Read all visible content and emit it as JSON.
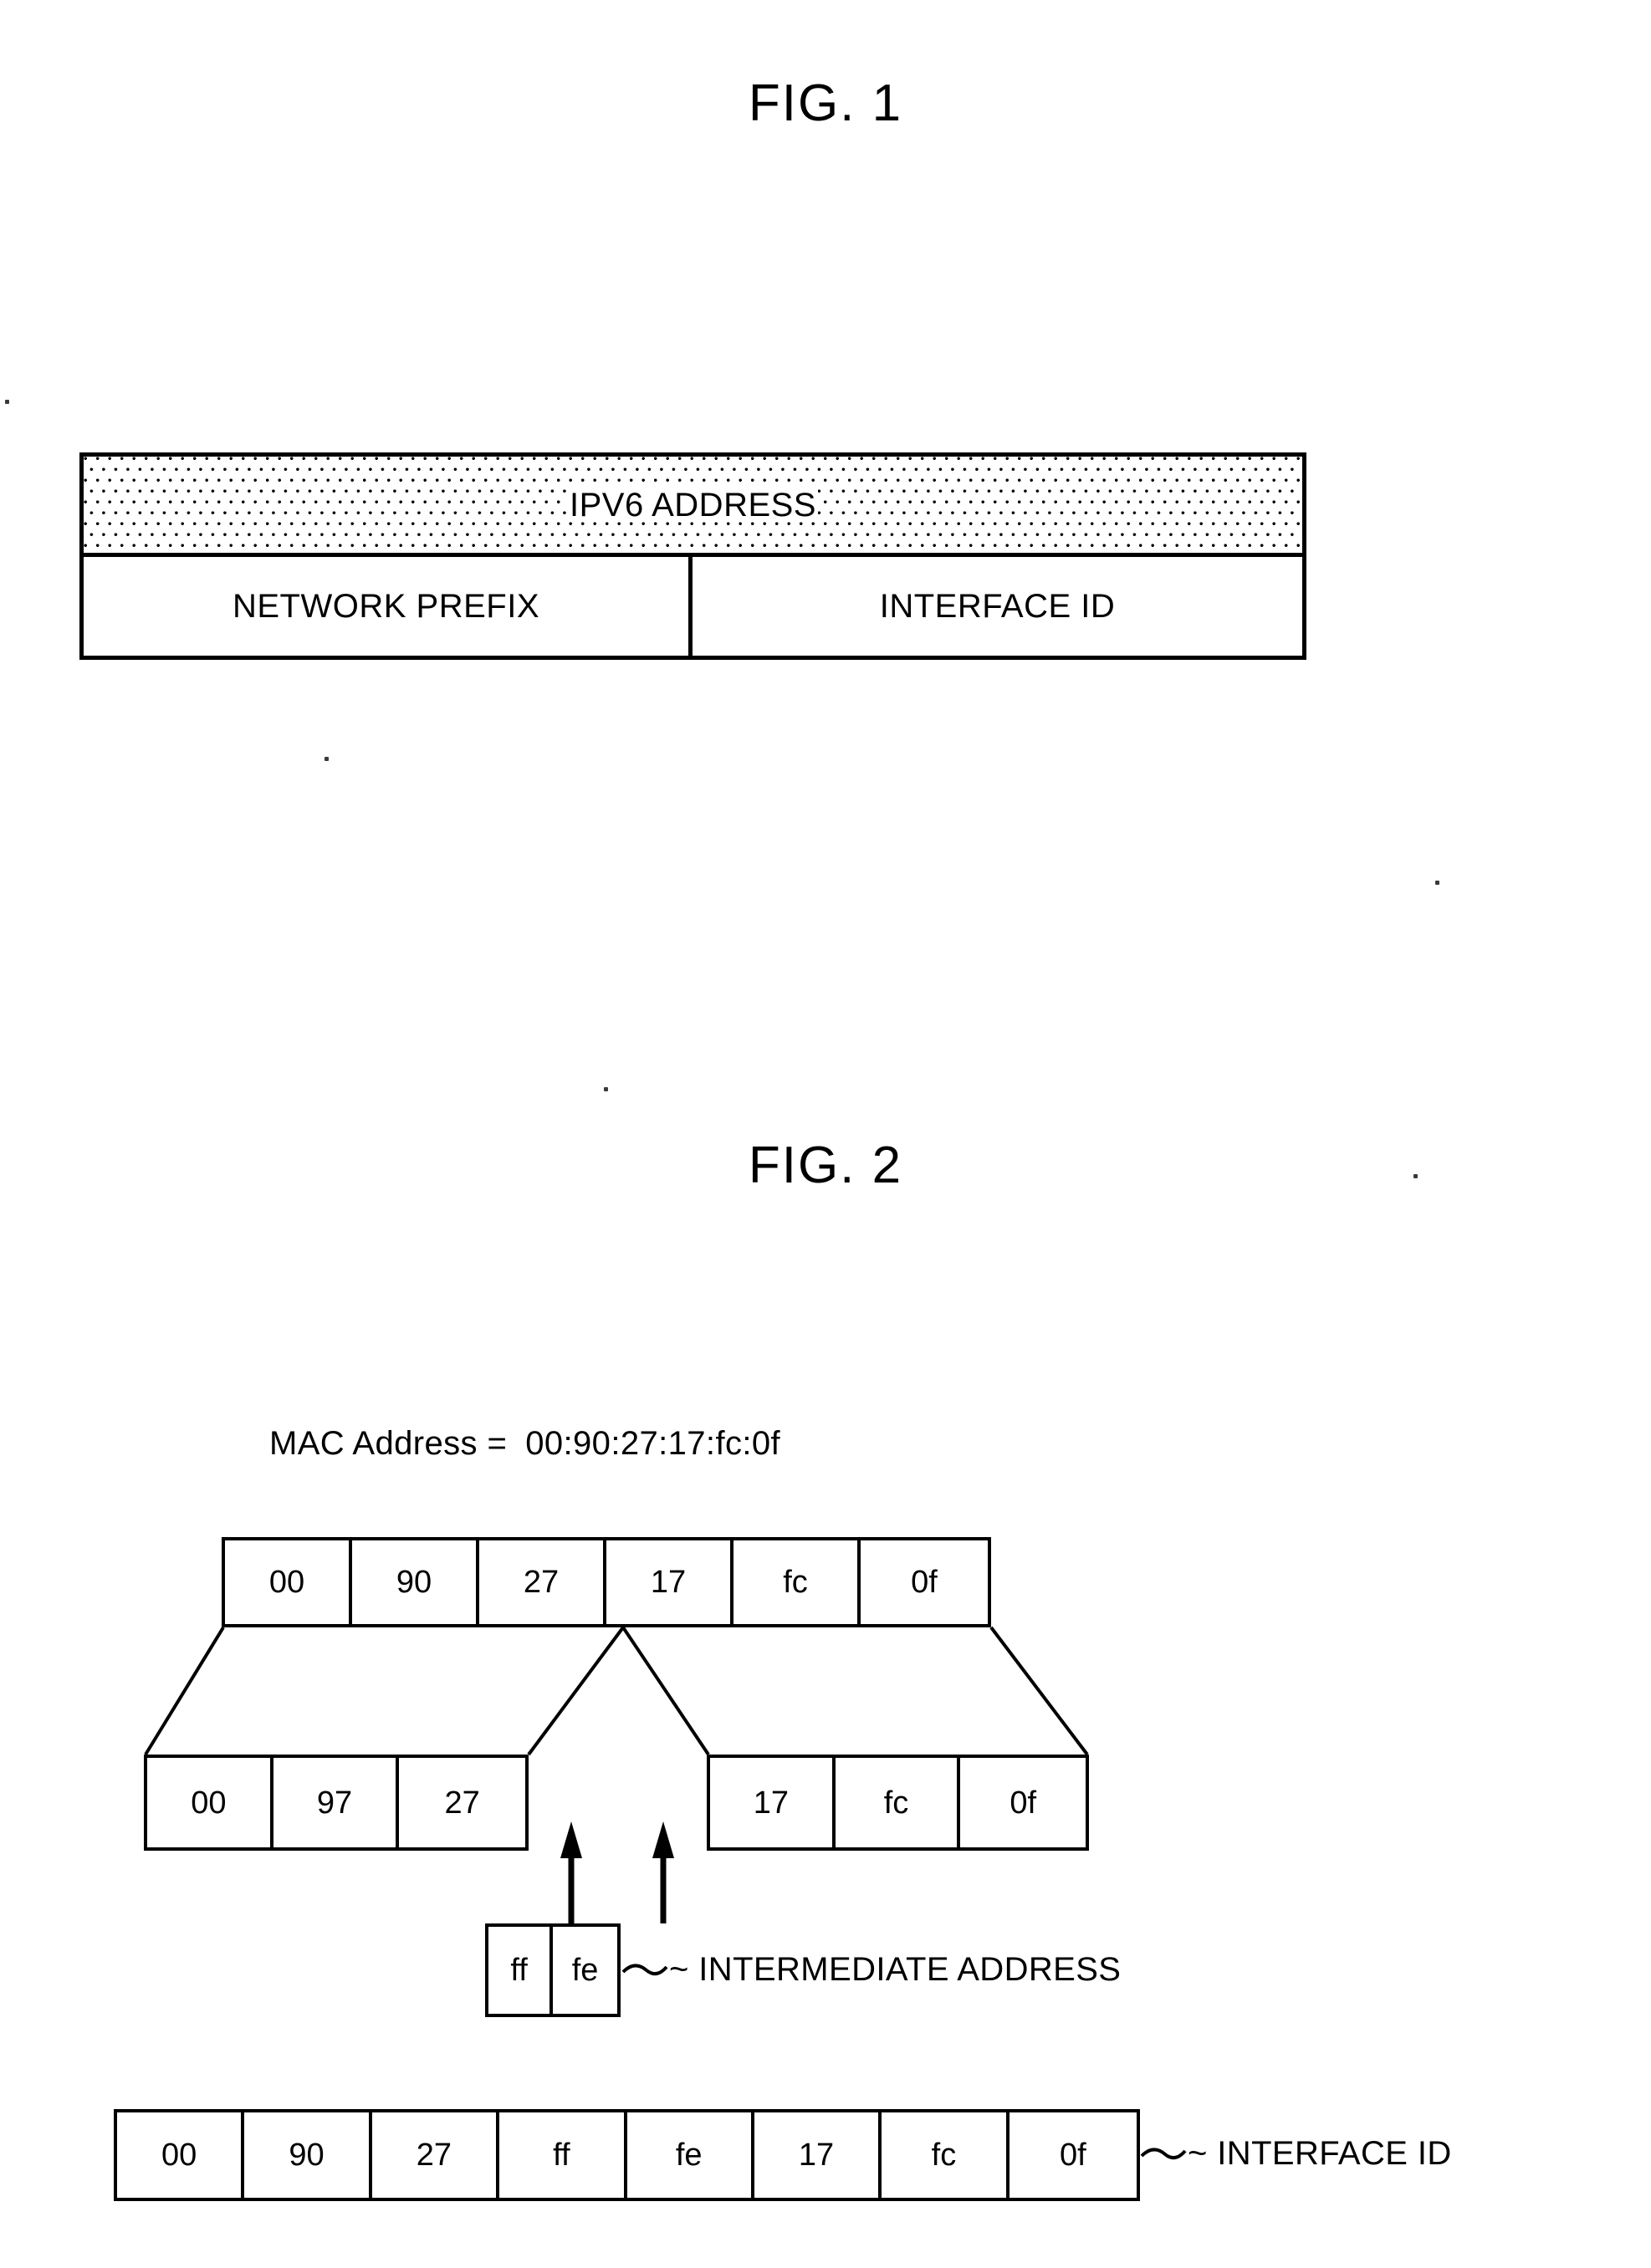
{
  "figures": [
    {
      "title": "FIG. 1",
      "band_label": "IPV6 ADDRESS",
      "prefix_label": "NETWORK PREFIX",
      "interface_label": "INTERFACE ID"
    },
    {
      "title": "FIG. 2",
      "mac_label": "MAC Address =",
      "mac_value": "00:90:27:17:fc:0f",
      "intermediate_callout": "~ INTERMEDIATE ADDRESS",
      "interface_callout": "~ INTERFACE ID"
    }
  ],
  "fig1": {
    "title": "FIG. 1",
    "band_label": "IPV6 ADDRESS",
    "prefix_label": "NETWORK PREFIX",
    "interface_label": "INTERFACE ID"
  },
  "fig2": {
    "title": "FIG. 2",
    "mac_label": "MAC Address =",
    "mac_value": "00:90:27:17:fc:0f",
    "mac_bytes": [
      "00",
      "90",
      "27",
      "17",
      "fc",
      "0f"
    ],
    "split_left_bytes": [
      "00",
      "97",
      "27"
    ],
    "split_right_bytes": [
      "17",
      "fc",
      "0f"
    ],
    "intermediate_bytes": [
      "ff",
      "fe"
    ],
    "interface_id_bytes": [
      "00",
      "90",
      "27",
      "ff",
      "fe",
      "17",
      "fc",
      "0f"
    ],
    "intermediate_callout": "~ INTERMEDIATE ADDRESS",
    "interface_callout": "~ INTERFACE ID"
  },
  "colors": {
    "ink": "#000000",
    "paper": "#ffffff"
  }
}
